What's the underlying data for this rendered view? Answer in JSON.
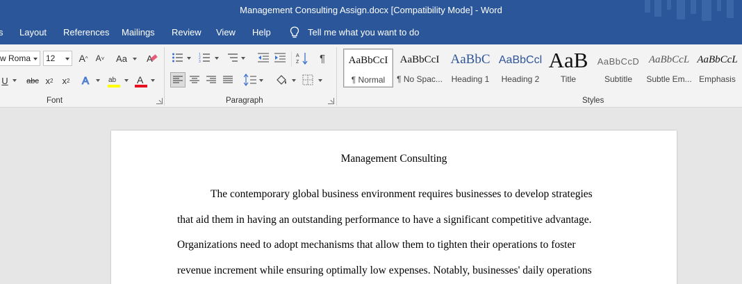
{
  "window": {
    "title": "Management Consulting Assign.docx [Compatibility Mode]  -  Word"
  },
  "menu": {
    "items": [
      "Layout",
      "References",
      "Mailings",
      "Review",
      "View",
      "Help"
    ],
    "tell_me": "Tell me what you want to do"
  },
  "font_group": {
    "font_name": "w Roma",
    "font_size": "12",
    "label": "Font",
    "change_case": "Aa"
  },
  "paragraph_group": {
    "label": "Paragraph"
  },
  "styles_group": {
    "label": "Styles",
    "items": [
      {
        "preview": "AaBbCcI",
        "label": "¶ Normal"
      },
      {
        "preview": "AaBbCcI",
        "label": "¶ No Spac..."
      },
      {
        "preview": "AaBbC",
        "label": "Heading 1"
      },
      {
        "preview": "AaBbCcl",
        "label": "Heading 2"
      },
      {
        "preview": "AaB",
        "label": "Title"
      },
      {
        "preview": "AaBbCcD",
        "label": "Subtitle"
      },
      {
        "preview": "AaBbCcL",
        "label": "Subtle Em..."
      },
      {
        "preview": "AaBbCcL",
        "label": "Emphasis"
      }
    ]
  },
  "document": {
    "title": "Management Consulting",
    "lines": [
      "The contemporary global business environment requires businesses to develop strategies",
      "that aid them in having an outstanding performance to have a significant competitive advantage.",
      "Organizations need to adopt mechanisms that allow them to tighten their operations to foster",
      "revenue increment while ensuring optimally low expenses. Notably, businesses' daily operations"
    ]
  },
  "colors": {
    "brand_blue": "#2b579a",
    "highlight_yellow": "#ffff00",
    "font_color_red": "#e81123"
  }
}
